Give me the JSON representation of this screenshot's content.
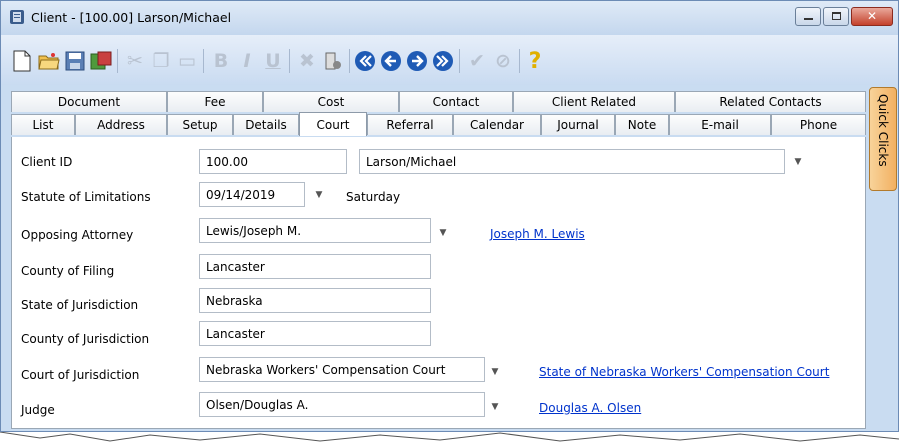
{
  "window": {
    "title": "Client - [100.00] Larson/Michael"
  },
  "tabs": {
    "row1": [
      "Document",
      "Fee",
      "Cost",
      "Contact",
      "Client Related",
      "Related Contacts"
    ],
    "row2": [
      "List",
      "Address",
      "Setup",
      "Details",
      "Court",
      "Referral",
      "Calendar",
      "Journal",
      "Note",
      "E-mail",
      "Phone"
    ],
    "active": "Court"
  },
  "side_panel": {
    "label": "Quick Clicks"
  },
  "toolbar": {
    "icons": [
      "new-document-icon",
      "open-folder-icon",
      "save-icon",
      "save-close-icon",
      "cut-icon",
      "copy-icon",
      "paste-icon",
      "bold-icon",
      "italic-icon",
      "underline-icon",
      "delete-icon",
      "print-icon",
      "first-record-icon",
      "previous-record-icon",
      "next-record-icon",
      "last-record-icon",
      "check-icon",
      "cancel-icon",
      "help-icon"
    ]
  },
  "form": {
    "client_id": {
      "label": "Client ID",
      "value": "100.00",
      "name_value": "Larson/Michael"
    },
    "statute": {
      "label": "Statute of Limitations",
      "value": "09/14/2019",
      "day": "Saturday"
    },
    "opposing_attorney": {
      "label": "Opposing Attorney",
      "value": "Lewis/Joseph M.",
      "link": "Joseph M. Lewis"
    },
    "county_filing": {
      "label": "County of Filing",
      "value": "Lancaster"
    },
    "state_jurisdiction": {
      "label": "State of Jurisdiction",
      "value": "Nebraska"
    },
    "county_jurisdiction": {
      "label": "County of Jurisdiction",
      "value": "Lancaster"
    },
    "court_jurisdiction": {
      "label": "Court of Jurisdiction",
      "value": "Nebraska Workers' Compensation Court",
      "link": "State of Nebraska Workers' Compensation Court"
    },
    "judge": {
      "label": "Judge",
      "value": "Olsen/Douglas A.",
      "link": "Douglas A. Olsen"
    }
  }
}
